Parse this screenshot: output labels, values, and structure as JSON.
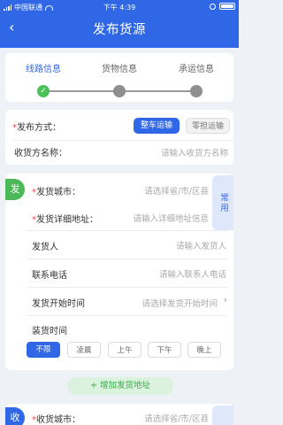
{
  "status_bar": {
    "carrier": "中国联通",
    "time": "下午 4:39"
  },
  "nav": {
    "back_icon": "‹",
    "title": "发布货源"
  },
  "steps": [
    {
      "label": "线路信息",
      "state": "done"
    },
    {
      "label": "货物信息",
      "state": "pending"
    },
    {
      "label": "承运信息",
      "state": "pending"
    }
  ],
  "info": {
    "publish_label": "发布方式：",
    "publish_required": "*",
    "option_full": "整车运输",
    "option_ltl": "零担运输",
    "receiver_label": "收货方名称：",
    "receiver_placeholder": "请输入收货方名称"
  },
  "ship": {
    "badge": "发",
    "common": "常用",
    "city_label": "发货城市：",
    "city_placeholder": "请选择省/市/区县",
    "addr_label": "发货详细地址：",
    "addr_placeholder": "请输入详细地址信息",
    "sender_label": "发货人",
    "sender_placeholder": "请输入发货人",
    "phone_label": "联系电话",
    "phone_placeholder": "请输入联系人电话",
    "start_label": "发货开始时间",
    "start_placeholder": "请选择发货开始时间",
    "load_label": "装货时间",
    "load_options": [
      "不限",
      "凌晨",
      "上午",
      "下午",
      "晚上"
    ],
    "load_selected": "不限"
  },
  "add_address": "+ 增加发货地址",
  "recv": {
    "badge": "收",
    "city_label": "收货城市：",
    "city_placeholder": "请选择省/市/区县"
  },
  "colors": {
    "primary": "#2f67e6",
    "success": "#4bb957",
    "required": "#e54848"
  }
}
